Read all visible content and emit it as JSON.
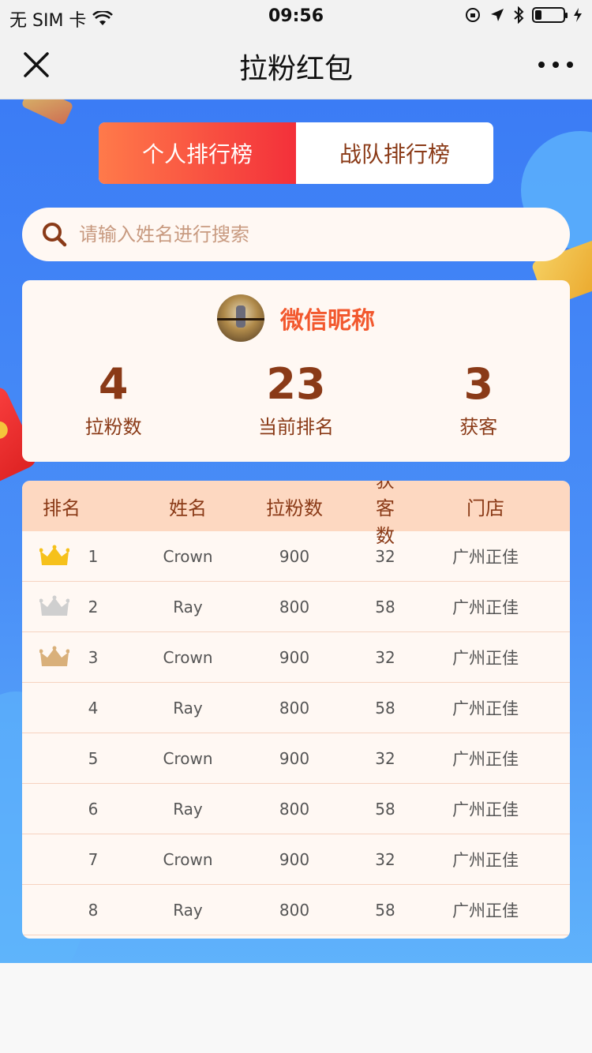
{
  "status_bar": {
    "carrier": "无 SIM 卡",
    "time": "09:56"
  },
  "nav": {
    "title": "拉粉红包"
  },
  "tabs": [
    {
      "label": "个人排行榜",
      "active": true
    },
    {
      "label": "战队排行榜",
      "active": false
    }
  ],
  "search": {
    "placeholder": "请输入姓名进行搜索"
  },
  "profile": {
    "nickname": "微信昵称",
    "stats": [
      {
        "value": "4",
        "label": "拉粉数"
      },
      {
        "value": "23",
        "label": "当前排名"
      },
      {
        "value": "3",
        "label": "获客"
      }
    ]
  },
  "table": {
    "headers": [
      "排名",
      "姓名",
      "拉粉数",
      "获客数",
      "门店"
    ],
    "rows": [
      {
        "rank": "1",
        "name": "Crown",
        "fans": "900",
        "customers": "32",
        "store": "广州正佳",
        "crown": "gold"
      },
      {
        "rank": "2",
        "name": "Ray",
        "fans": "800",
        "customers": "58",
        "store": "广州正佳",
        "crown": "silver"
      },
      {
        "rank": "3",
        "name": "Crown",
        "fans": "900",
        "customers": "32",
        "store": "广州正佳",
        "crown": "bronze"
      },
      {
        "rank": "4",
        "name": "Ray",
        "fans": "800",
        "customers": "58",
        "store": "广州正佳",
        "crown": ""
      },
      {
        "rank": "5",
        "name": "Crown",
        "fans": "900",
        "customers": "32",
        "store": "广州正佳",
        "crown": ""
      },
      {
        "rank": "6",
        "name": "Ray",
        "fans": "800",
        "customers": "58",
        "store": "广州正佳",
        "crown": ""
      },
      {
        "rank": "7",
        "name": "Crown",
        "fans": "900",
        "customers": "32",
        "store": "广州正佳",
        "crown": ""
      },
      {
        "rank": "8",
        "name": "Ray",
        "fans": "800",
        "customers": "58",
        "store": "广州正佳",
        "crown": ""
      }
    ]
  },
  "colors": {
    "gold": "#f6c11b",
    "silver": "#cfcfcf",
    "bronze": "#d9b07a",
    "brand_brown": "#8a3a17",
    "accent_orange": "#f2582e"
  }
}
